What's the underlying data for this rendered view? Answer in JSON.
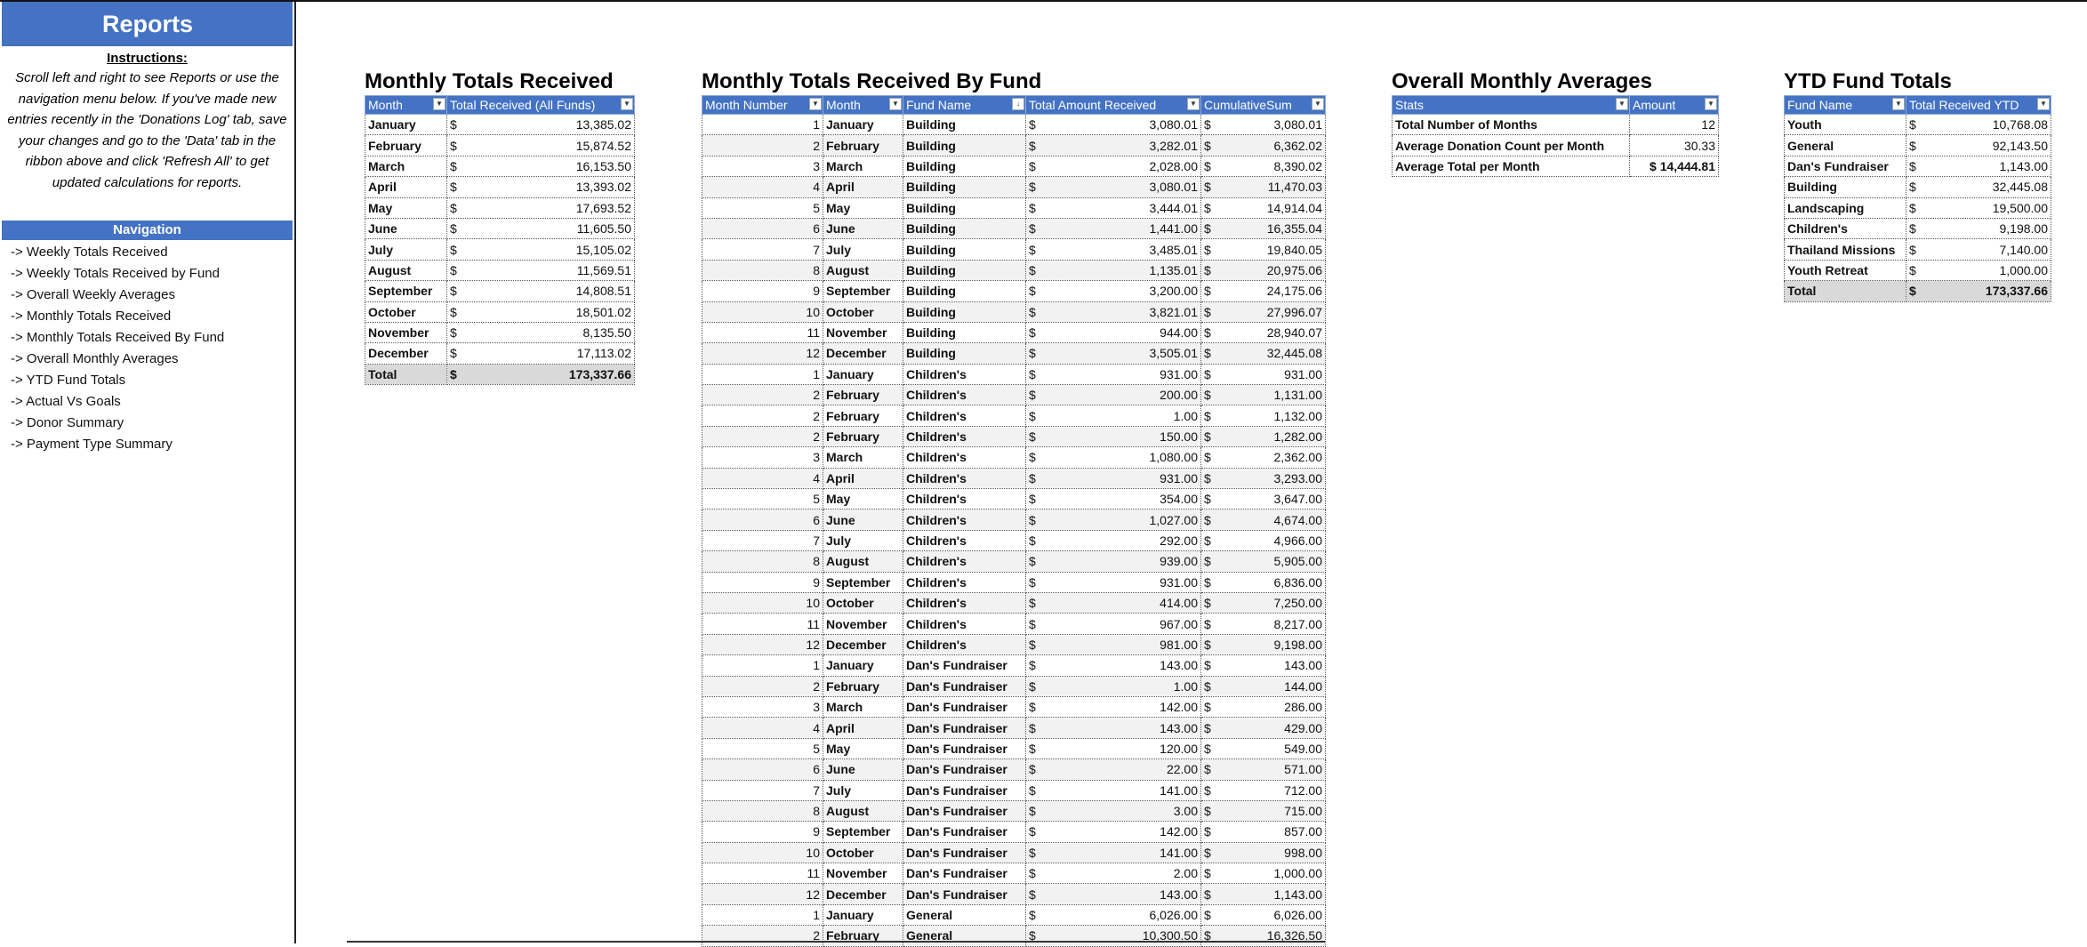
{
  "sidebar": {
    "title": "Reports",
    "instructions_heading": "Instructions:",
    "instructions_text": "Scroll left and right to see Reports or use the navigation menu below. If you've made new entries recently in the 'Donations Log' tab, save your changes and go to the  'Data' tab in the ribbon above and click 'Refresh All' to get updated calculations for reports.",
    "nav_heading": "Navigation",
    "nav_items": [
      "-> Weekly Totals Received",
      "-> Weekly Totals Received by Fund",
      "-> Overall Weekly Averages",
      "-> Monthly Totals Received",
      "-> Monthly Totals Received By Fund",
      "-> Overall Monthly Averages",
      "-> YTD Fund Totals",
      "-> Actual Vs Goals",
      "-> Donor Summary",
      "-> Payment Type Summary"
    ]
  },
  "currency_symbol": "$",
  "monthly_totals": {
    "title": "Monthly Totals Received",
    "headers": [
      "Month",
      "Total Received (All Funds)"
    ],
    "rows": [
      [
        "January",
        "13,385.02"
      ],
      [
        "February",
        "15,874.52"
      ],
      [
        "March",
        "16,153.50"
      ],
      [
        "April",
        "13,393.02"
      ],
      [
        "May",
        "17,693.52"
      ],
      [
        "June",
        "11,605.50"
      ],
      [
        "July",
        "15,105.02"
      ],
      [
        "August",
        "11,569.51"
      ],
      [
        "September",
        "14,808.51"
      ],
      [
        "October",
        "18,501.02"
      ],
      [
        "November",
        "8,135.50"
      ],
      [
        "December",
        "17,113.02"
      ]
    ],
    "total_label": "Total",
    "total_value": "173,337.66"
  },
  "monthly_by_fund": {
    "title": "Monthly Totals Received By Fund",
    "headers": [
      "Month Number",
      "Month",
      "Fund Name",
      "Total Amount Received",
      "CumulativeSum"
    ],
    "rows": [
      [
        "1",
        "January",
        "Building",
        "3,080.01",
        "3,080.01"
      ],
      [
        "2",
        "February",
        "Building",
        "3,282.01",
        "6,362.02"
      ],
      [
        "3",
        "March",
        "Building",
        "2,028.00",
        "8,390.02"
      ],
      [
        "4",
        "April",
        "Building",
        "3,080.01",
        "11,470.03"
      ],
      [
        "5",
        "May",
        "Building",
        "3,444.01",
        "14,914.04"
      ],
      [
        "6",
        "June",
        "Building",
        "1,441.00",
        "16,355.04"
      ],
      [
        "7",
        "July",
        "Building",
        "3,485.01",
        "19,840.05"
      ],
      [
        "8",
        "August",
        "Building",
        "1,135.01",
        "20,975.06"
      ],
      [
        "9",
        "September",
        "Building",
        "3,200.00",
        "24,175.06"
      ],
      [
        "10",
        "October",
        "Building",
        "3,821.01",
        "27,996.07"
      ],
      [
        "11",
        "November",
        "Building",
        "944.00",
        "28,940.07"
      ],
      [
        "12",
        "December",
        "Building",
        "3,505.01",
        "32,445.08"
      ],
      [
        "1",
        "January",
        "Children's",
        "931.00",
        "931.00"
      ],
      [
        "2",
        "February",
        "Children's",
        "200.00",
        "1,131.00"
      ],
      [
        "2",
        "February",
        "Children's",
        "1.00",
        "1,132.00"
      ],
      [
        "2",
        "February",
        "Children's",
        "150.00",
        "1,282.00"
      ],
      [
        "3",
        "March",
        "Children's",
        "1,080.00",
        "2,362.00"
      ],
      [
        "4",
        "April",
        "Children's",
        "931.00",
        "3,293.00"
      ],
      [
        "5",
        "May",
        "Children's",
        "354.00",
        "3,647.00"
      ],
      [
        "6",
        "June",
        "Children's",
        "1,027.00",
        "4,674.00"
      ],
      [
        "7",
        "July",
        "Children's",
        "292.00",
        "4,966.00"
      ],
      [
        "8",
        "August",
        "Children's",
        "939.00",
        "5,905.00"
      ],
      [
        "9",
        "September",
        "Children's",
        "931.00",
        "6,836.00"
      ],
      [
        "10",
        "October",
        "Children's",
        "414.00",
        "7,250.00"
      ],
      [
        "11",
        "November",
        "Children's",
        "967.00",
        "8,217.00"
      ],
      [
        "12",
        "December",
        "Children's",
        "981.00",
        "9,198.00"
      ],
      [
        "1",
        "January",
        "Dan's Fundraiser",
        "143.00",
        "143.00"
      ],
      [
        "2",
        "February",
        "Dan's Fundraiser",
        "1.00",
        "144.00"
      ],
      [
        "3",
        "March",
        "Dan's Fundraiser",
        "142.00",
        "286.00"
      ],
      [
        "4",
        "April",
        "Dan's Fundraiser",
        "143.00",
        "429.00"
      ],
      [
        "5",
        "May",
        "Dan's Fundraiser",
        "120.00",
        "549.00"
      ],
      [
        "6",
        "June",
        "Dan's Fundraiser",
        "22.00",
        "571.00"
      ],
      [
        "7",
        "July",
        "Dan's Fundraiser",
        "141.00",
        "712.00"
      ],
      [
        "8",
        "August",
        "Dan's Fundraiser",
        "3.00",
        "715.00"
      ],
      [
        "9",
        "September",
        "Dan's Fundraiser",
        "142.00",
        "857.00"
      ],
      [
        "10",
        "October",
        "Dan's Fundraiser",
        "141.00",
        "998.00"
      ],
      [
        "11",
        "November",
        "Dan's Fundraiser",
        "2.00",
        "1,000.00"
      ],
      [
        "12",
        "December",
        "Dan's Fundraiser",
        "143.00",
        "1,143.00"
      ],
      [
        "1",
        "January",
        "General",
        "6,026.00",
        "6,026.00"
      ],
      [
        "2",
        "February",
        "General",
        "10,300.50",
        "16,326.50"
      ]
    ]
  },
  "monthly_averages": {
    "title": "Overall Monthly Averages",
    "headers": [
      "Stats",
      "Amount"
    ],
    "rows": [
      [
        "Total Number of Months",
        "12"
      ],
      [
        "Average Donation Count per Month",
        "30.33"
      ],
      [
        "Average Total per Month",
        "$ 14,444.81"
      ]
    ]
  },
  "ytd_fund_totals": {
    "title": "YTD Fund Totals",
    "headers": [
      "Fund Name",
      "Total Received YTD"
    ],
    "rows": [
      [
        "Youth",
        "10,768.08"
      ],
      [
        "General",
        "92,143.50"
      ],
      [
        "Dan's Fundraiser",
        "1,143.00"
      ],
      [
        "Building",
        "32,445.08"
      ],
      [
        "Landscaping",
        "19,500.00"
      ],
      [
        "Children's",
        "9,198.00"
      ],
      [
        "Thailand Missions",
        "7,140.00"
      ],
      [
        "Youth Retreat",
        "1,000.00"
      ]
    ],
    "total_label": "Total",
    "total_value": "173,337.66"
  },
  "colors": {
    "header_blue": "#4472c4",
    "total_grey": "#d9d9d9"
  }
}
